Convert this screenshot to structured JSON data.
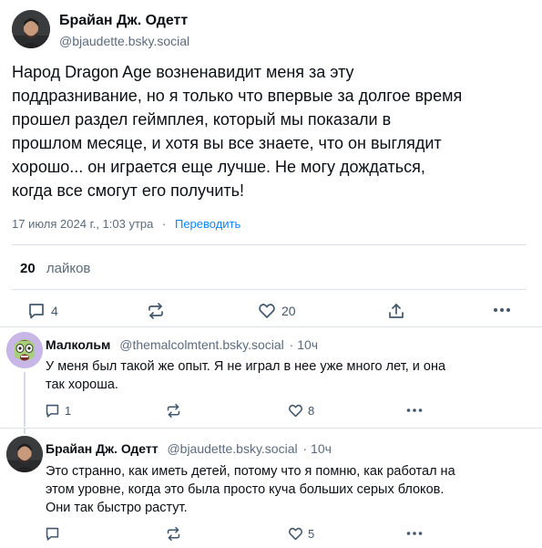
{
  "post": {
    "author_name": "Брайан Дж. Одетт",
    "author_handle": "@bjaudette.bsky.social",
    "text_lines": [
      "Народ Dragon Age возненавидит меня за эту",
      "поддразнивание, но я только что впервые за долгое время",
      "прошел раздел геймплея, который мы показали в",
      "прошлом месяце, и хотя вы все знаете, что он выглядит",
      "хорошо... он играется еще лучше. Не могу дождаться,",
      "когда все смогут его получить!"
    ],
    "timestamp": "17 июля 2024 г., 1:03 утра",
    "separator": "·",
    "translate_label": "Переводить",
    "likes_count": "20",
    "likes_label": "лайков",
    "actions": {
      "reply_icon": "reply-icon",
      "reply_count": "4",
      "repost_icon": "repost-icon",
      "like_icon": "heart-icon",
      "like_count": "20",
      "share_icon": "share-icon",
      "more_icon": "more-icon"
    }
  },
  "replies": [
    {
      "author_name": "Малкольм",
      "author_handle": "@themalcolmtent.bsky.social",
      "age": "· 10ч",
      "text_lines": [
        "У меня был такой же опыт. Я не играл в нее уже много лет, и она",
        "так хороша."
      ],
      "reply_count": "1",
      "like_count": "8"
    },
    {
      "author_name": "Брайан Дж. Одетт",
      "author_handle": "@bjaudette.bsky.social",
      "age": "· 10ч",
      "text_lines": [
        "Это странно, как иметь детей, потому что я помню, как работал на",
        "этом уровне, когда это была просто куча больших серых блоков.",
        "Они так быстро растут."
      ],
      "reply_count": "",
      "like_count": "5"
    }
  ],
  "colors": {
    "accent": "#1083fe",
    "muted": "#5b6b7d",
    "divider": "#d9e0e8"
  }
}
